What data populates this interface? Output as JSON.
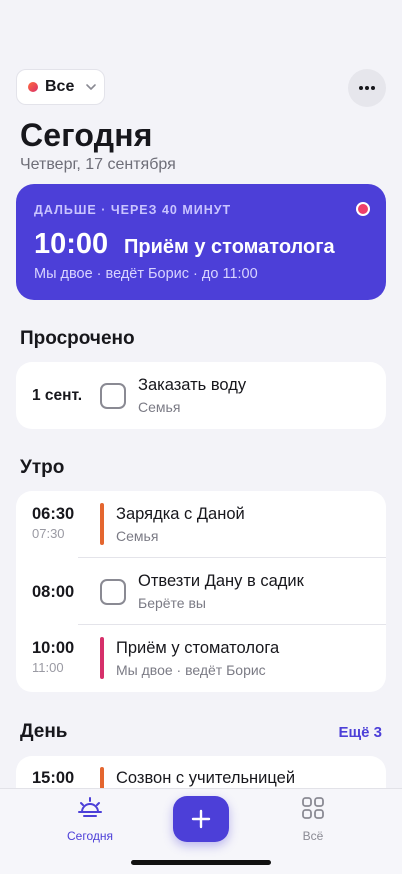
{
  "filter": {
    "label": "Все"
  },
  "header": {
    "title": "Сегодня",
    "subtitle": "Четверг, 17 сентября"
  },
  "next_up": {
    "eyebrow": "ДАЛЬШЕ · ЧЕРЕЗ 40 МИНУТ",
    "time": "10:00",
    "title": "Приём у стоматолога",
    "meta": "Мы двое · ведёт Борис · до 11:00"
  },
  "overdue": {
    "title": "Просрочено",
    "items": [
      {
        "date": "1 сент.",
        "title": "Заказать воду",
        "subtitle": "Семья"
      }
    ]
  },
  "morning": {
    "title": "Утро",
    "items": [
      {
        "time": "06:30",
        "end": "07:30",
        "title": "Зарядка с Даной",
        "subtitle": "Семья",
        "color": "#e4662f"
      },
      {
        "time": "08:00",
        "title": "Отвезти Дану в садик",
        "subtitle": "Берёте вы"
      },
      {
        "time": "10:00",
        "end": "11:00",
        "title": "Приём у стоматолога",
        "subtitle": "Мы двое · ведёт Борис",
        "color": "#d6306a"
      }
    ]
  },
  "day": {
    "title": "День",
    "more": "Ещё 3",
    "items": [
      {
        "time": "15:00",
        "title": "Созвон с учительницей",
        "color": "#e4662f"
      }
    ]
  },
  "tabs": {
    "today": "Сегодня",
    "all": "Всё"
  },
  "colors": {
    "accent": "#4c3fd8",
    "orange": "#e4662f",
    "pink": "#d6306a"
  }
}
